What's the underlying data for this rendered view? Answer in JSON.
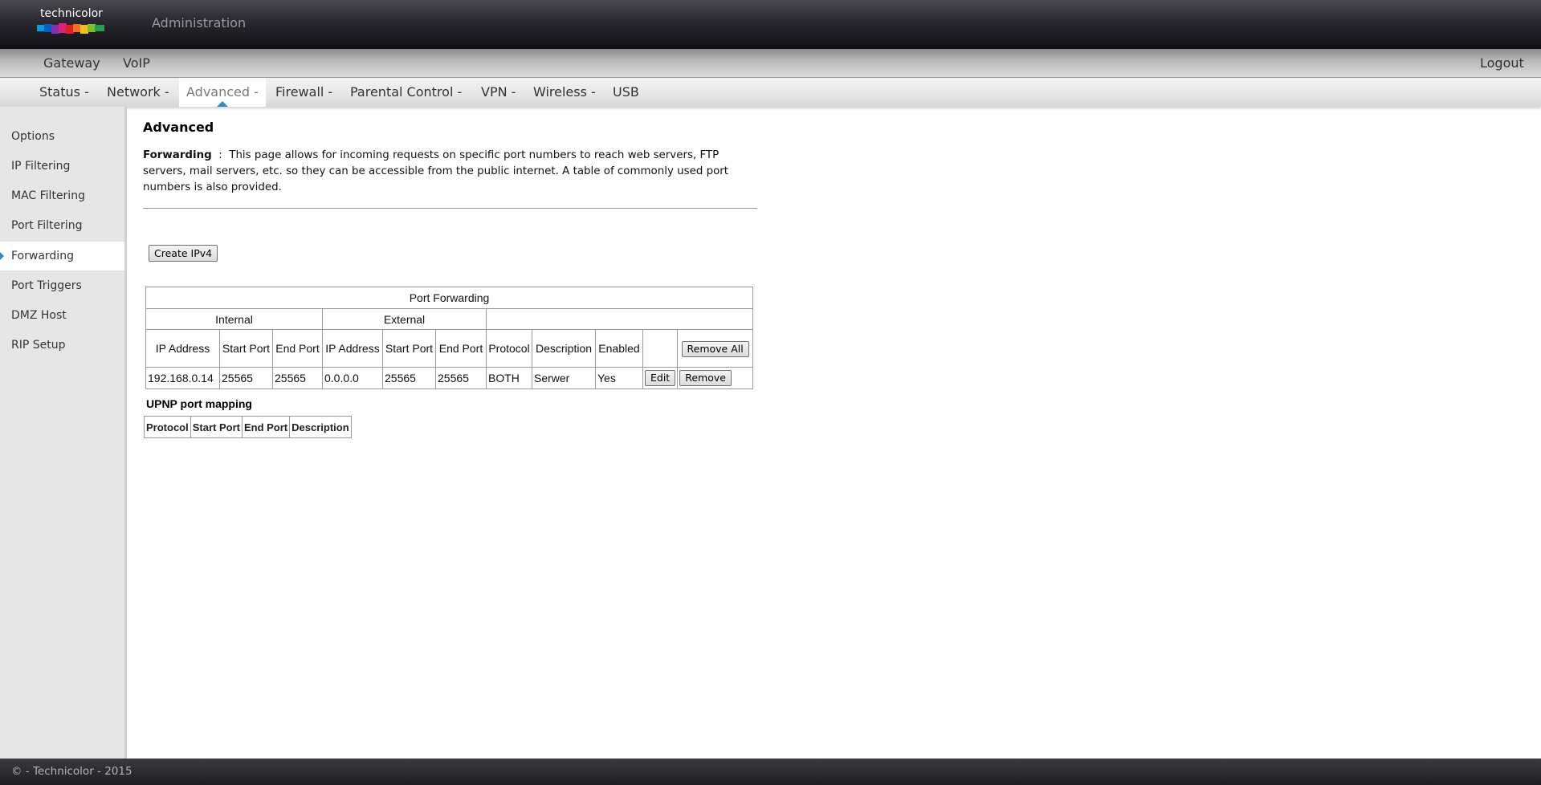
{
  "header": {
    "logo_text": "technicolor",
    "title": "Administration",
    "logo_colors": [
      "#00a0e0",
      "#0060c0",
      "#8030b0",
      "#e0207c",
      "#e02020",
      "#f07020",
      "#f0c020",
      "#80c020",
      "#20a050"
    ]
  },
  "topnav": {
    "items": [
      "Gateway",
      "VoIP"
    ],
    "logout": "Logout"
  },
  "subnav": {
    "items": [
      "Status -",
      "Network -",
      "Advanced -",
      "Firewall -",
      "Parental Control -",
      "VPN -",
      "Wireless -",
      "USB"
    ],
    "active": "Advanced -"
  },
  "sidebar": {
    "items": [
      "Options",
      "IP Filtering",
      "MAC Filtering",
      "Port Filtering",
      "Forwarding",
      "Port Triggers",
      "DMZ Host",
      "RIP Setup"
    ],
    "active": "Forwarding"
  },
  "main": {
    "title": "Advanced",
    "desc_label": "Forwarding",
    "desc_sep": ":",
    "desc_text": "This page allows for incoming requests on specific port numbers to reach web servers, FTP servers, mail servers, etc. so they can be accessible from the public internet. A table of commonly used port numbers is also provided.",
    "create_button": "Create IPv4"
  },
  "port_forwarding": {
    "title": "Port Forwarding",
    "group_internal": "Internal",
    "group_external": "External",
    "columns": {
      "ip": "IP Address",
      "start_port": "Start Port",
      "end_port": "End Port",
      "ext_ip": "IP Address",
      "ext_start_port": "Start Port",
      "ext_end_port": "End Port",
      "protocol": "Protocol",
      "description": "Description",
      "enabled": "Enabled"
    },
    "remove_all_button": "Remove All",
    "rows": [
      {
        "ip": "192.168.0.14",
        "start_port": "25565",
        "end_port": "25565",
        "ext_ip": "0.0.0.0",
        "ext_start_port": "25565",
        "ext_end_port": "25565",
        "protocol": "BOTH",
        "description": "Serwer",
        "enabled": "Yes",
        "edit_button": "Edit",
        "remove_button": "Remove"
      }
    ]
  },
  "upnp": {
    "title": "UPNP port mapping",
    "columns": [
      "Protocol",
      "Start Port",
      "End Port",
      "Description"
    ]
  },
  "footer": {
    "text": "© - Technicolor - 2015"
  }
}
